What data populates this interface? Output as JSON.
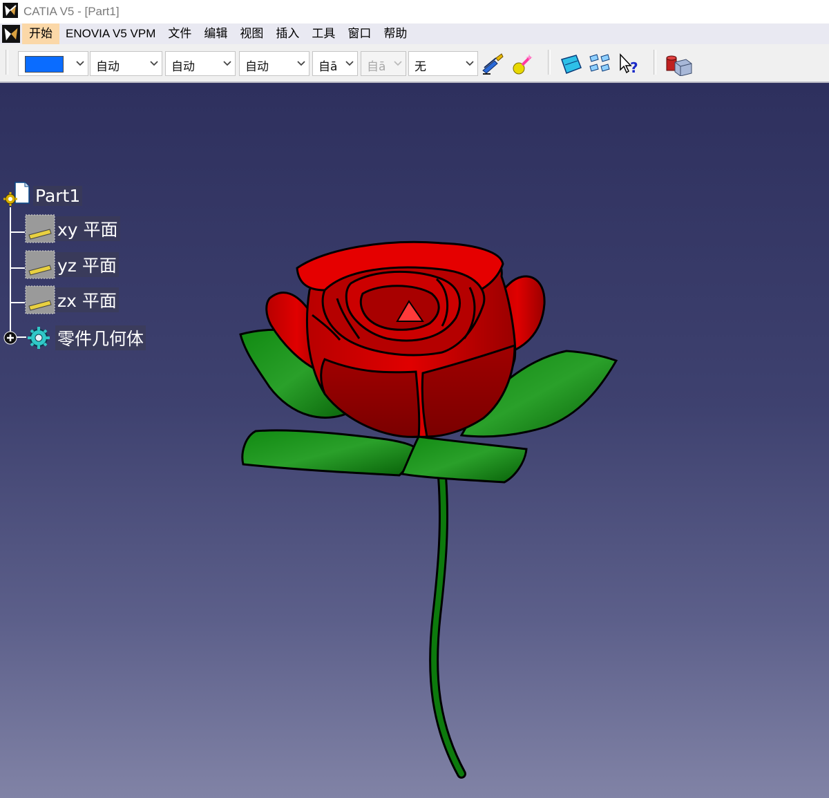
{
  "app": {
    "title": "CATIA V5 - [Part1]"
  },
  "menu": {
    "items": [
      "开始",
      "ENOVIA V5 VPM",
      "文件",
      "编辑",
      "视图",
      "插入",
      "工具",
      "窗口",
      "帮助"
    ]
  },
  "toolbar": {
    "color_swatch": "#0a6cff",
    "combos": [
      {
        "value": "自动"
      },
      {
        "value": "自动"
      },
      {
        "value": "自动"
      },
      {
        "value": "自ā"
      },
      {
        "value": "自ā"
      },
      {
        "value": "无"
      }
    ]
  },
  "tree": {
    "root": "Part1",
    "children": [
      "xy 平面",
      "yz 平面",
      "zx 平面",
      "零件几何体"
    ]
  },
  "colors": {
    "petal": "#d10000",
    "leaf": "#0f7a10",
    "stem": "#0b6a0b",
    "background": "#2e305e"
  }
}
